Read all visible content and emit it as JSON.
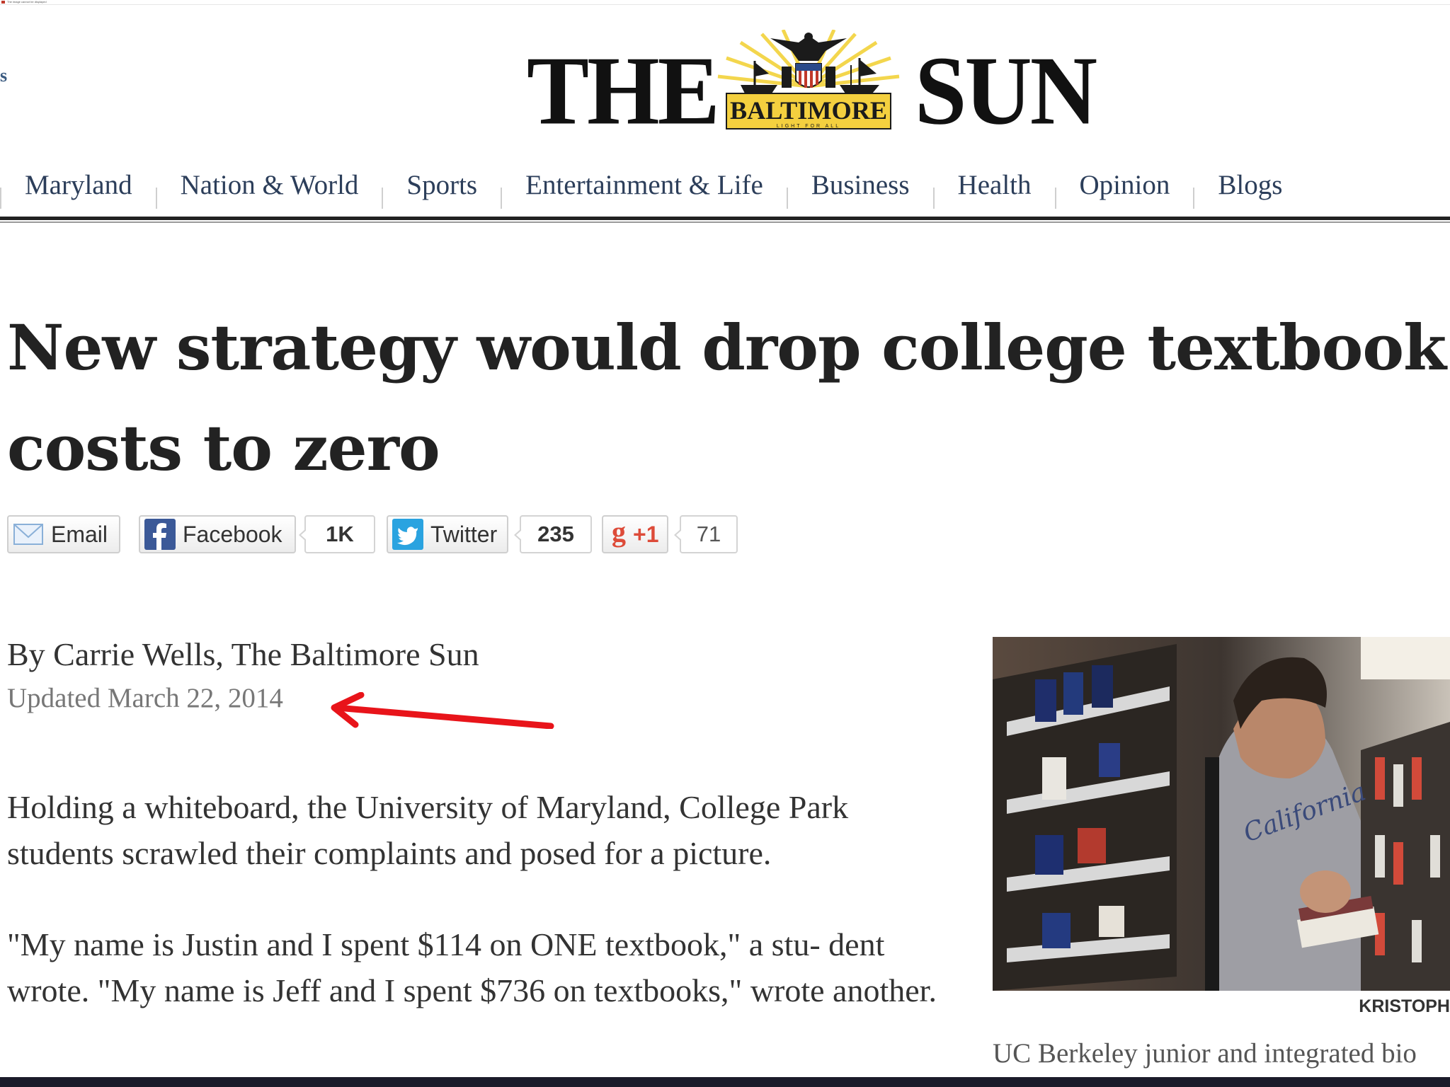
{
  "browser": {
    "tab_title": "The image cannot be displayed"
  },
  "edge_fragment": "s",
  "masthead": {
    "the": "THE",
    "sun": "SUN",
    "emblem_word": "BALTIMORE",
    "tagline": "LIGHT FOR ALL"
  },
  "nav": {
    "items": [
      {
        "label": "Maryland"
      },
      {
        "label": "Nation & World"
      },
      {
        "label": "Sports"
      },
      {
        "label": "Entertainment & Life"
      },
      {
        "label": "Business"
      },
      {
        "label": "Health"
      },
      {
        "label": "Opinion"
      },
      {
        "label": "Blogs"
      }
    ]
  },
  "article": {
    "headline": "New strategy would drop college textbook costs to zero",
    "byline": "By Carrie Wells, The Baltimore Sun",
    "updated": "Updated March 22, 2014",
    "paragraphs": [
      "Holding a whiteboard, the University of Maryland, College Park students scrawled their complaints and posed for a picture.",
      "\"My name is Justin and I spent $114 on ONE textbook,\" a stu- dent wrote. \"My name is Jeff and I spent $736 on textbooks,\" wrote another."
    ]
  },
  "share": {
    "email_label": "Email",
    "facebook_label": "Facebook",
    "facebook_count": "1K",
    "twitter_label": "Twitter",
    "twitter_count": "235",
    "gplus_label": "+1",
    "gplus_count": "71",
    "colors": {
      "facebook": "#3b5998",
      "twitter": "#2aa3e0",
      "gplus": "#dd4b39"
    }
  },
  "photo": {
    "credit": "KRISTOPH",
    "caption": "UC Berkeley junior and integrated bio",
    "shirt_text": "California"
  },
  "annotation": {
    "arrow_color": "#e8141a"
  }
}
